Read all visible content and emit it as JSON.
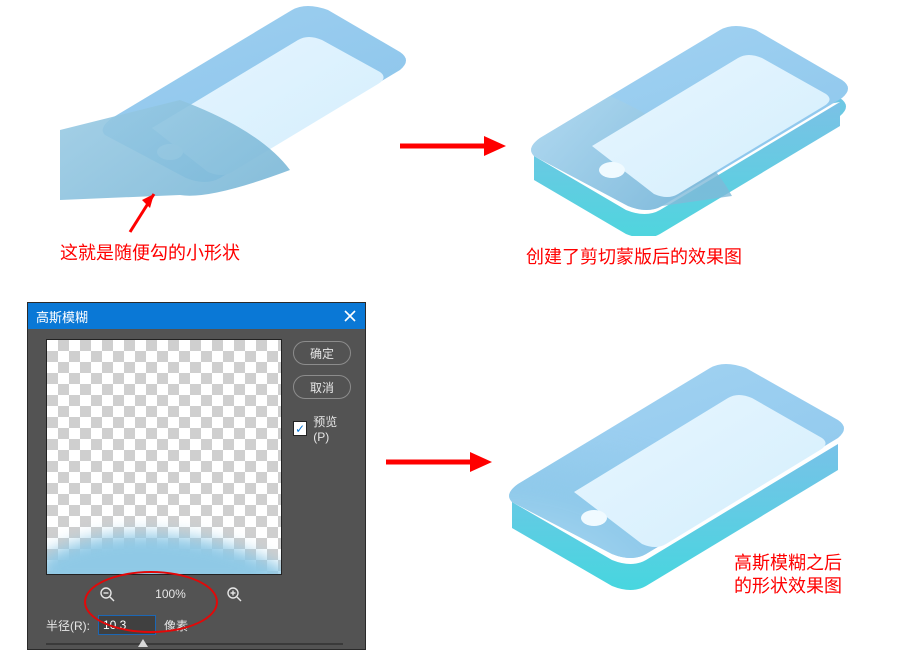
{
  "annotations": {
    "shape_note": "这就是随便勾的小形状",
    "after_clip": "创建了剪切蒙版后的效果图",
    "after_blur_line1": "高斯模糊之后",
    "after_blur_line2": "的形状效果图"
  },
  "dialog": {
    "title": "高斯模糊",
    "ok": "确定",
    "cancel": "取消",
    "preview_label": "预览(P)",
    "zoom_level": "100%",
    "radius_label": "半径(R):",
    "radius_value": "10.3",
    "radius_unit": "像素"
  },
  "chart_data": {
    "type": "table",
    "title": "Gaussian Blur dialog – radius parameter",
    "series": [
      {
        "name": "半径(R)",
        "values": [
          10.3
        ],
        "unit": "像素"
      }
    ],
    "zoom": "100%",
    "preview": true
  },
  "icons": {
    "close": "×",
    "check": "✓",
    "zoom_out": "−",
    "zoom_in": "+"
  }
}
